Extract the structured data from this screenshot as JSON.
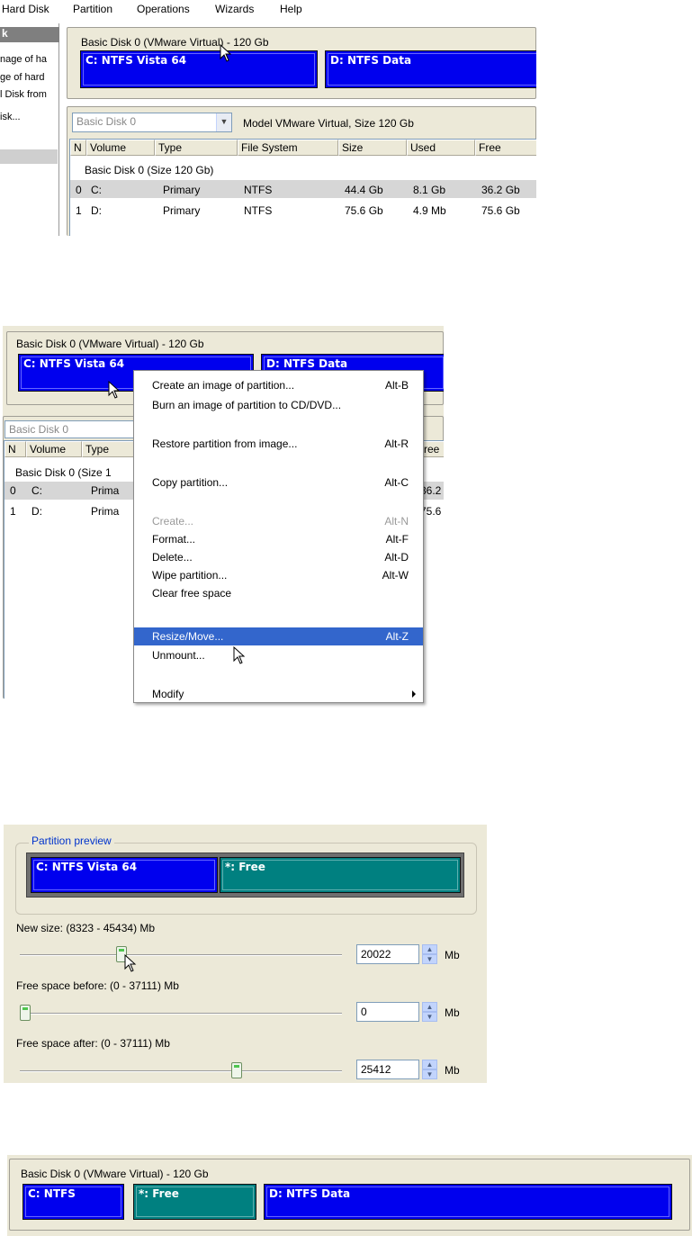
{
  "menubar": {
    "items": [
      "Hard Disk",
      "Partition",
      "Operations",
      "Wizards",
      "Help"
    ]
  },
  "sidebar": {
    "header": "k",
    "items": [
      "nage of ha",
      "ge of hard",
      "l Disk from",
      "isk..."
    ]
  },
  "disk_map": {
    "title": "Basic Disk 0 (VMware Virtual) - 120 Gb",
    "partitions": [
      {
        "label": "C: NTFS Vista 64",
        "color": "#0000ee"
      },
      {
        "label": "D: NTFS Data",
        "color": "#0000ee"
      }
    ]
  },
  "disk_panel": {
    "combo_value": "Basic Disk 0",
    "model_text": "Model VMware Virtual, Size 120 Gb",
    "columns": [
      "N",
      "Volume",
      "Type",
      "File System",
      "Size",
      "Used",
      "Free"
    ],
    "group_label": "Basic Disk 0 (Size 120 Gb)",
    "rows": [
      {
        "n": "0",
        "volume": "C:",
        "type": "Primary",
        "fs": "NTFS",
        "size": "44.4 Gb",
        "used": "8.1 Gb",
        "free": "36.2 Gb"
      },
      {
        "n": "1",
        "volume": "D:",
        "type": "Primary",
        "fs": "NTFS",
        "size": "75.6 Gb",
        "used": "4.9 Mb",
        "free": "75.6 Gb"
      }
    ]
  },
  "screen2": {
    "disk_title": "Basic Disk 0 (VMware Virtual) - 120 Gb",
    "part_c": "C: NTFS Vista 64",
    "part_d": "D: NTFS Data",
    "combo_value": "Basic Disk 0",
    "columns_visible": [
      "N",
      "Volume",
      "Type",
      "ree"
    ],
    "group_label": "Basic Disk 0 (Size 1",
    "rows": [
      {
        "n": "0",
        "volume": "C:",
        "type": "Prima",
        "free": "36.2"
      },
      {
        "n": "1",
        "volume": "D:",
        "type": "Prima",
        "free": "75.6"
      }
    ]
  },
  "context_menu": {
    "items": [
      {
        "label": "Create an image of partition...",
        "accel": "Alt-B"
      },
      {
        "label": "Burn an image of partition to CD/DVD...",
        "accel": ""
      },
      {
        "label": "Restore partition from image...",
        "accel": "Alt-R"
      },
      {
        "label": "Copy partition...",
        "accel": "Alt-C"
      },
      {
        "label": "Create...",
        "accel": "Alt-N",
        "disabled": true
      },
      {
        "label": "Format...",
        "accel": "Alt-F"
      },
      {
        "label": "Delete...",
        "accel": "Alt-D"
      },
      {
        "label": "Wipe partition...",
        "accel": "Alt-W"
      },
      {
        "label": "Clear free space",
        "accel": ""
      },
      {
        "label": "Resize/Move...",
        "accel": "Alt-Z",
        "highlighted": true
      },
      {
        "label": "Unmount...",
        "accel": ""
      },
      {
        "label": "Modify",
        "accel": "",
        "submenu": true
      }
    ]
  },
  "resize_dialog": {
    "group_title": "Partition preview",
    "preview_c": "C: NTFS Vista 64",
    "preview_free": "*: Free",
    "new_size_label": "New size: (8323 - 45434) Mb",
    "new_size_value": "20022",
    "new_size_fraction": 0.31,
    "free_before_label": "Free space before: (0 - 37111) Mb",
    "free_before_value": "0",
    "free_before_fraction": 0.0,
    "free_after_label": "Free space after: (0 - 37111) Mb",
    "free_after_value": "25412",
    "free_after_fraction": 0.68,
    "unit": "Mb"
  },
  "result_map": {
    "title": "Basic Disk 0 (VMware Virtual) - 120 Gb",
    "partitions": [
      {
        "label": "C: NTFS",
        "color": "#0000ee"
      },
      {
        "label": "*: Free",
        "color": "#008080"
      },
      {
        "label": "D: NTFS Data",
        "color": "#0000ee"
      }
    ]
  },
  "colors": {
    "partition_ntfs": "#0000ee",
    "partition_free": "#008080",
    "menu_highlight": "#3366cc",
    "dialog_background": "#ece9d8"
  }
}
